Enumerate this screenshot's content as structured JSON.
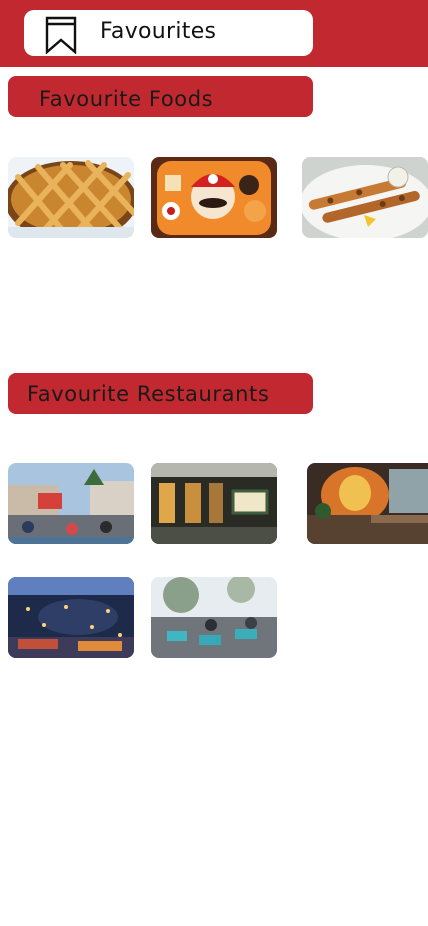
{
  "header": {
    "title": "Favourites",
    "icon": "bookmark-icon",
    "background": "#c1282f"
  },
  "sections": [
    {
      "title": "Favourite Foods",
      "items": [
        {
          "name": "lattice-pie",
          "image": "photo"
        },
        {
          "name": "mario-bento",
          "image": "photo"
        },
        {
          "name": "chicken-skewers",
          "image": "photo"
        }
      ]
    },
    {
      "title": "Favourite Restaurants",
      "items": [
        {
          "name": "outdoor-courtyard-restaurant",
          "image": "photo"
        },
        {
          "name": "street-cafe-front",
          "image": "photo"
        },
        {
          "name": "mural-dining-hall",
          "image": "photo"
        },
        {
          "name": "night-market-aerial",
          "image": "photo"
        },
        {
          "name": "garden-terrace-cafe",
          "image": "photo"
        }
      ]
    }
  ],
  "colors": {
    "accent": "#c1282f",
    "pill": "#ffffff"
  }
}
